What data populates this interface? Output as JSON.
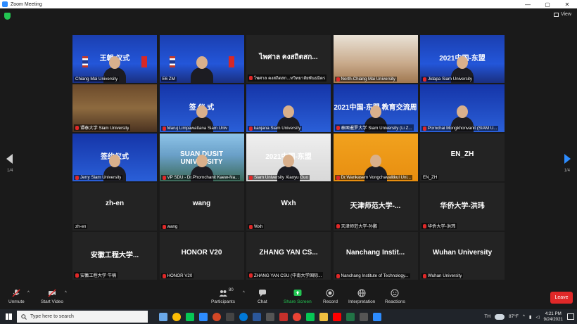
{
  "window": {
    "title": "Zoom Meeting",
    "controls": [
      "—",
      "▢",
      "✕"
    ]
  },
  "view_label": "View",
  "pages": {
    "left": "1/4",
    "right": "1/4"
  },
  "tiles": [
    {
      "label": "Chiang Mai University",
      "muted": false,
      "active": true,
      "style": "v-blue",
      "screen": "王朝 仪式"
    },
    {
      "label": "E6 ZM",
      "muted": false,
      "style": "v-blue",
      "screen": ""
    },
    {
      "label": "ไพศาล คงสถิตสก...ทวิทยาลัยพันธมิตร",
      "muted": true,
      "style": "",
      "name": "ไพศาล คงสถิตสก..."
    },
    {
      "label": "North-Chiang Mai University",
      "muted": true,
      "style": "v-roomlight",
      "screen": ""
    },
    {
      "label": "Jidapa Siam University",
      "muted": true,
      "style": "v-blue",
      "screen": "2021中国-东盟"
    },
    {
      "label": "谭泰大学 Siam University",
      "muted": true,
      "style": "v-room",
      "screen": ""
    },
    {
      "label": "Maruj Limpawattana Siam Univ",
      "muted": true,
      "style": "v-slide",
      "screen": "签 仪 式"
    },
    {
      "label": "kanjana Siam University",
      "muted": true,
      "style": "v-slide",
      "screen": ""
    },
    {
      "label": "泰国暹罗大学 Siam University (Li Z...",
      "muted": true,
      "style": "v-slide",
      "screen": "2021中国-东盟 教育交流周"
    },
    {
      "label": "Pornchai Mongkhonvanit (SIAM U...",
      "muted": true,
      "style": "v-slide",
      "screen": ""
    },
    {
      "label": "Jerry Siam University",
      "muted": true,
      "style": "v-slide",
      "screen": "签约仪式"
    },
    {
      "label": "VP SDU - Dr.Phornchanit Kaew-Na...",
      "muted": true,
      "style": "v-campus",
      "screen": "SUAN DUSIT UNIVERSITY"
    },
    {
      "label": "Siam University Xiaoyu Guo",
      "muted": true,
      "style": "v-white",
      "screen": "2021中国-东盟"
    },
    {
      "label": "Dr.Wankasem Vongchavalitkul Uni...",
      "muted": true,
      "style": "v-orange",
      "screen": ""
    },
    {
      "label": "EN_ZH",
      "muted": false,
      "style": "",
      "name": "EN_ZH"
    },
    {
      "label": "zh-en",
      "muted": false,
      "style": "",
      "name": "zh-en"
    },
    {
      "label": "wang",
      "muted": true,
      "style": "",
      "name": "wang"
    },
    {
      "label": "Wxh",
      "muted": true,
      "style": "",
      "name": "Wxh"
    },
    {
      "label": "天津师范大学-孙鹏",
      "muted": true,
      "style": "",
      "name": "天津师范大学-..."
    },
    {
      "label": "华侨大学-洪玮",
      "muted": true,
      "style": "",
      "name": "华侨大学-洪玮"
    },
    {
      "label": "安徽工程大学 牛楠",
      "muted": true,
      "style": "",
      "name": "安徽工程大学..."
    },
    {
      "label": "HONOR V20",
      "muted": true,
      "style": "",
      "name": "HONOR V20"
    },
    {
      "label": "ZHANG YAN CSU (中南大学国际...",
      "muted": true,
      "style": "",
      "name": "ZHANG YAN CS..."
    },
    {
      "label": "Nanchang Institute of Technology...",
      "muted": true,
      "style": "",
      "name": "Nanchang Instit..."
    },
    {
      "label": "Wuhan University",
      "muted": true,
      "style": "",
      "name": "Wuhan University"
    }
  ],
  "toolbar": {
    "unmute": "Unmute",
    "start_video": "Start Video",
    "participants": "Participants",
    "participants_count": "80",
    "chat": "Chat",
    "share_screen": "Share Screen",
    "record": "Record",
    "interpretation": "Interpretation",
    "reactions": "Reactions",
    "leave": "Leave"
  },
  "taskbar": {
    "search_placeholder": "Type here to search",
    "lang": "TH",
    "temp": "87°F",
    "time": "4:21 PM",
    "date": "9/24/2021"
  },
  "colors": {
    "accent": "#2d8cff",
    "leave": "#e02828",
    "active_speaker": "#c7d94a",
    "share": "#23c552"
  }
}
